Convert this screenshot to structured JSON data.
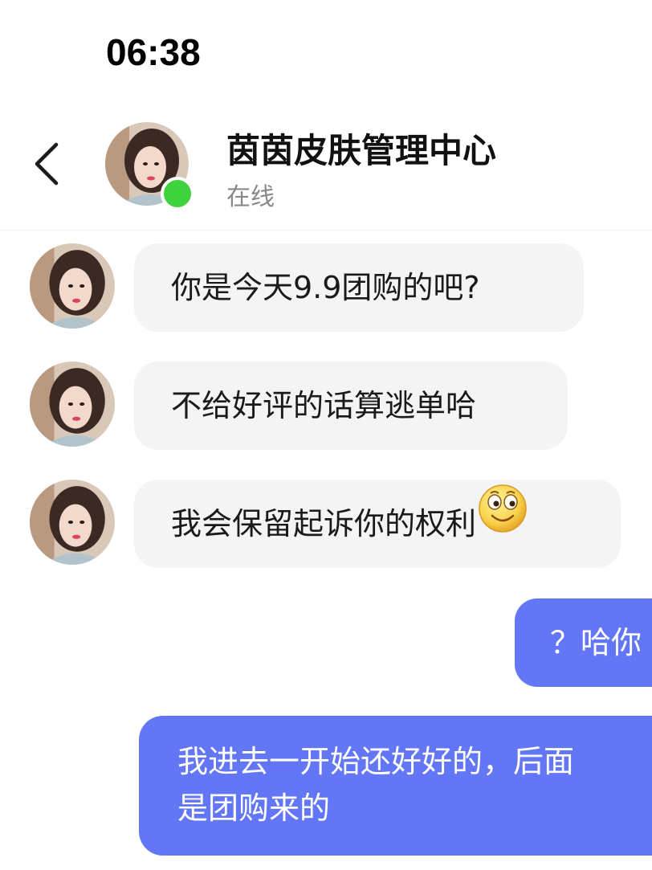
{
  "status_bar": {
    "time": "06:38"
  },
  "header": {
    "contact_name": "茵茵皮肤管理中心",
    "status": "在线"
  },
  "messages": [
    {
      "direction": "incoming",
      "text": "你是今天9.9团购的吧?"
    },
    {
      "direction": "incoming",
      "text": "不给好评的话算逃单哈"
    },
    {
      "direction": "incoming",
      "text": "我会保留起诉你的权利",
      "emoji": "smiling-face-emoji"
    },
    {
      "direction": "outgoing",
      "text": "？哈你"
    },
    {
      "direction": "outgoing",
      "lines": [
        "我进去一开始还好好的，后面",
        "是团购来的"
      ]
    }
  ],
  "colors": {
    "outgoing_bubble": "#6276f6",
    "incoming_bubble": "#f4f4f5",
    "online_dot": "#3fd23f"
  },
  "icons": {
    "back": "chevron-left-icon"
  }
}
